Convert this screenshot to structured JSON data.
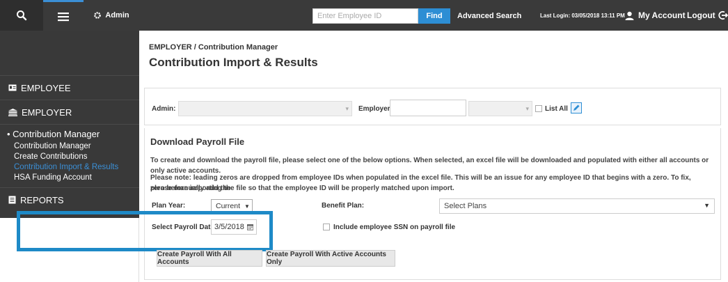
{
  "topbar": {
    "admin_label": "Admin",
    "employee_id_placeholder": "Enter Employee ID",
    "find_label": "Find",
    "advanced_search_label": "Advanced Search",
    "last_login": "Last Login: 03/05/2018 13:11 PM",
    "my_account_label": "My Account",
    "logout_label": "Logout"
  },
  "sidebar": {
    "employee_label": "EMPLOYEE",
    "employer_label": "EMPLOYER",
    "active_section": "• Contribution Manager",
    "sub_items": [
      {
        "label": "Contribution Manager"
      },
      {
        "label": "Create Contributions"
      },
      {
        "label": "Contribution Import & Results"
      },
      {
        "label": "HSA Funding Account"
      }
    ],
    "reports_label": "REPORTS"
  },
  "main": {
    "breadcrumb": "EMPLOYER / Contribution Manager",
    "title": "Contribution Import & Results",
    "filters": {
      "admin_label": "Admin:",
      "employer_label": "Employer:",
      "list_all_label": "List All"
    },
    "download": {
      "title": "Download Payroll File",
      "instructions": "To create and download the payroll file, please select one of the below options. When selected, an excel file will be downloaded and populated with either all accounts or only active accounts.",
      "note_line1": "Please note: leading zeros are dropped from employee IDs when populated in the excel file. This will be an issue for any employee ID that begins with a zero. To fix, please manually add the",
      "note_line2": "zero before importing the file so that the employee ID will be properly matched upon import.",
      "plan_year_label": "Plan Year:",
      "plan_year_value": "Current",
      "benefit_plan_label": "Benefit Plan:",
      "benefit_plan_value": "Select Plans",
      "payroll_date_label": "Select Payroll Date:",
      "payroll_date_value": "3/5/2018",
      "include_ssn_label": "Include employee SSN on payroll file",
      "btn_all": "Create Payroll With All Accounts",
      "btn_active": "Create Payroll With Active Accounts Only"
    }
  },
  "colors": {
    "topbar_bg": "#3a3a3a",
    "sidebar_bg": "#393939",
    "accent_blue": "#2d8ed4",
    "highlight_border": "#1e8ac7"
  }
}
